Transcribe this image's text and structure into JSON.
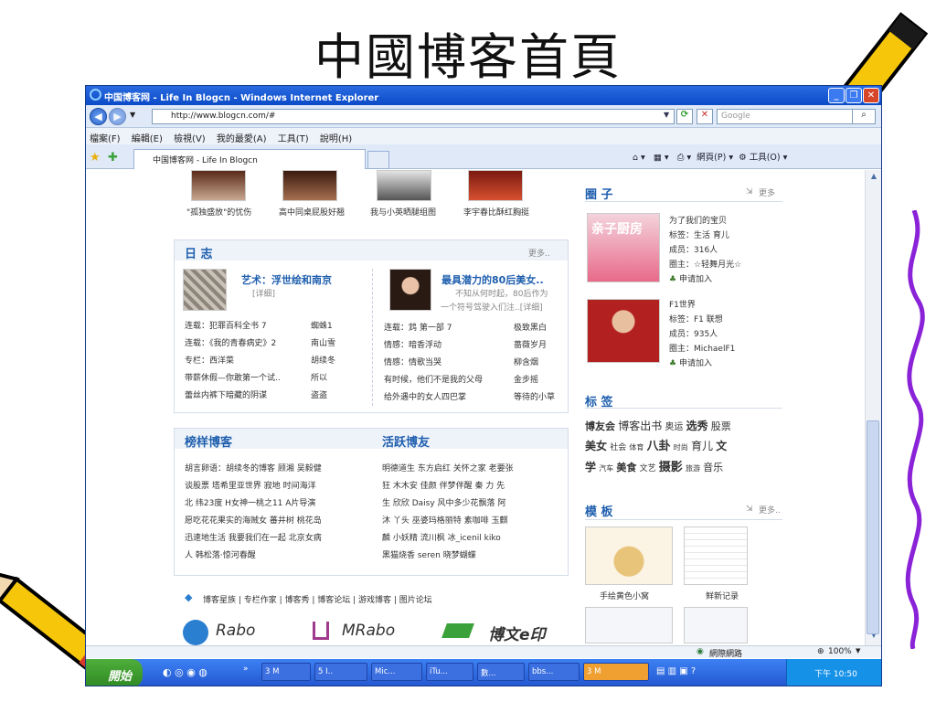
{
  "slide_title": "中國博客首頁",
  "window": {
    "title": "中国博客网 - Life In Blogcn - Windows Internet Explorer",
    "url": "http://www.blogcn.com/#",
    "search_placeholder": "Google",
    "menu": [
      "檔案(F)",
      "編輯(E)",
      "檢視(V)",
      "我的最愛(A)",
      "工具(T)",
      "說明(H)"
    ],
    "tab_label": "中国博客网 - Life In Blogcn",
    "cmd": {
      "page": "網頁(P)",
      "tools": "工具(O)"
    }
  },
  "page": {
    "top_captions": [
      "\"孤独盛放\"的忧伤",
      "高中同桌屁股好翘",
      "我与小英晒腿组图",
      "李宇春比酥红胸挺"
    ],
    "diary": {
      "title": "日  志",
      "more": "更多..",
      "feature_left": {
        "title": "艺术：浮世绘和南京",
        "detail": "[详细]"
      },
      "feature_right": {
        "title": "最具潜力的80后美女..",
        "desc1": "不知从何时起，80后作为",
        "desc2": "一个符号驾驶入们注..[详细]"
      },
      "left_rows": [
        [
          "连载：犯罪百科全书  7",
          "蜘蛛1"
        ],
        [
          "连载：《我的青春病史》2",
          "南山雪"
        ],
        [
          "专栏：西洋菜",
          "胡续冬"
        ],
        [
          "带薪休假—你敢第一个试..",
          "所以"
        ],
        [
          "蕾丝内裤下暗藏的阴谋",
          "盗盗"
        ]
      ],
      "right_rows": [
        [
          "连载：鸩  第一部  7",
          "极致黑白"
        ],
        [
          "情感：暗香浮动",
          "蔷薇岁月"
        ],
        [
          "情感：情歌当哭",
          "柳含烟"
        ],
        [
          "有时候，他们不是我的父母",
          "金步摇"
        ],
        [
          "给外遇中的女人四巴掌",
          "等待的小草"
        ]
      ]
    },
    "model_bloggers": {
      "title": "榜样博客",
      "lines": [
        "胡言卵语：胡续冬的博客  顾湘  吴毅健",
        "谈股票  塔希里亚世界  寂地 时间海洋",
        "北 纬23度  H女神一桃之11  A片导演",
        "愿吃花花果实的海贼女  蕃井树  桃花岛",
        "迅速地生活  我要我们在一起  北京女病",
        "人  韩松落·惊河春醒"
      ]
    },
    "active_bloggers": {
      "title": "活跃博友",
      "lines": [
        "明德道生  东方启红  关怀之家  老要张",
        "狂  木木安  佳颜  伴梦伴醒  秦 力 先",
        "生  欣欣  Daisy  风中多少花飘落  阿",
        "沐  丫头  巫婆玛格丽特  素咖啡  玉麒",
        "麟  小妖精  流川枫  冰_icenil  kiko",
        "黑猫烧香  seren  晓梦蝴蝶"
      ]
    },
    "footer_links": "博客星族 | 专栏作家 | 博客秀 | 博客论坛 | 游戏博客 | 图片论坛",
    "logos": [
      "Rabo",
      "MRabo",
      "博文e印"
    ],
    "circles": {
      "title": "圈  子",
      "more": "更多",
      "c1": {
        "badge": "亲子厨房",
        "name": "为了我们的宝贝",
        "tags": "标签：生活 育儿",
        "members": "成员：316人",
        "owner": "圈主：☆轻舞月光☆",
        "join": "申请加入"
      },
      "c2": {
        "name": "F1世界",
        "tags": "标签：F1 联想",
        "members": "成员：935人",
        "owner": "圈主：MichaelF1",
        "join": "申请加入"
      }
    },
    "tags": {
      "title": "标  签",
      "line1": [
        "博友会",
        "博客出书",
        "奥运",
        "选秀",
        "股票"
      ],
      "line2": [
        "美女",
        "社会",
        "体育",
        "八卦",
        "时尚",
        "育儿",
        "文"
      ],
      "line3": [
        "学",
        "汽车",
        "美食",
        "文艺",
        "摄影",
        "旅游",
        "音乐"
      ]
    },
    "templates": {
      "title": "模  板",
      "more": "更多..",
      "items": [
        "手绘黄色小窝",
        "鲜新记录"
      ]
    }
  },
  "status": {
    "zone": "網際網路",
    "zoom": "100%"
  },
  "taskbar": {
    "start": "開始",
    "tasks": [
      "3 M",
      "5 I..",
      "Mic...",
      "iTu...",
      "數...",
      "bbs...",
      "3 M"
    ],
    "clock": "下午 10:50"
  },
  "colors": {
    "accent": "#1f5fae",
    "title_bar": "#0b4bc8",
    "taskbar": "#2356d0",
    "start": "#3a9a2e"
  }
}
